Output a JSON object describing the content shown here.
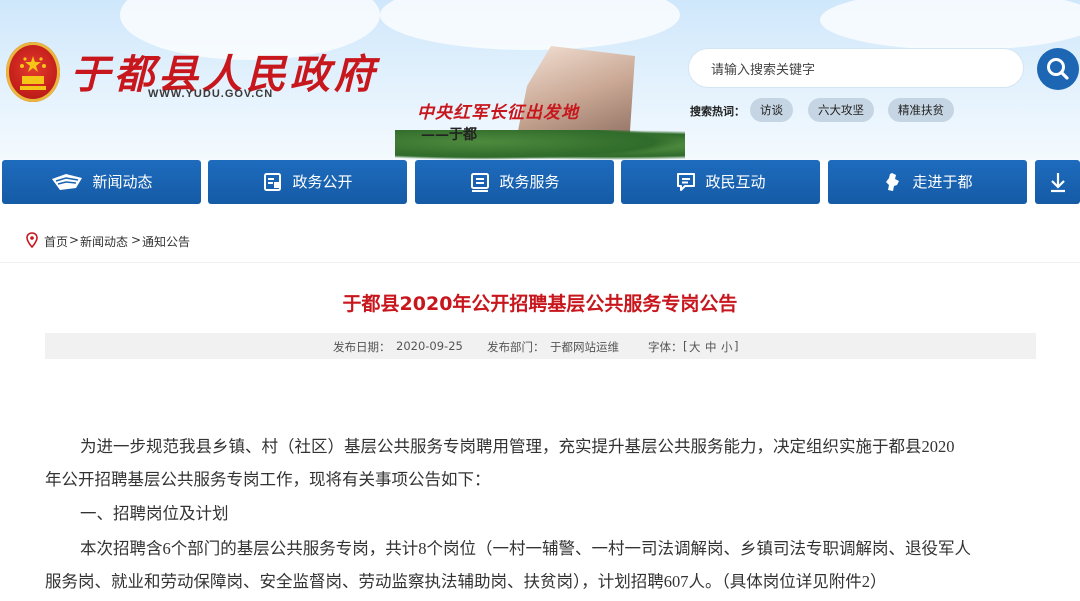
{
  "header": {
    "site_name": "于都县人民政府",
    "site_url": "WWW.YUDU.GOV.CN",
    "slogan": "中央红军长征出发地",
    "slogan_sub": "——于都",
    "search_placeholder": "请输入搜索关键字",
    "hot_label": "搜索热词：",
    "hot_tags": [
      "访谈",
      "六大攻坚",
      "精准扶贫"
    ]
  },
  "nav": {
    "items": [
      {
        "label": "新闻动态",
        "icon": "news-icon"
      },
      {
        "label": "政务公开",
        "icon": "document-icon"
      },
      {
        "label": "政务服务",
        "icon": "service-icon"
      },
      {
        "label": "政民互动",
        "icon": "chat-icon"
      },
      {
        "label": "走进于都",
        "icon": "map-icon"
      }
    ],
    "more_icon": "arrow-down-icon"
  },
  "breadcrumb": {
    "home": "首页",
    "sep": ">",
    "section": "新闻动态",
    "page": "通知公告"
  },
  "article": {
    "title": "于都县2020年公开招聘基层公共服务专岗公告",
    "date_label": "发布日期：",
    "date": "2020-09-25",
    "dept_label": "发布部门：",
    "dept": "于都网站运维",
    "font_label": "字体：",
    "font_open": "[",
    "font_large": "大",
    "font_medium": "中",
    "font_small": "小",
    "font_close": "]",
    "p1_line1": "为进一步规范我县乡镇、村（社区）基层公共服务专岗聘用管理，充实提升基层公共服务能力，决定组织实施于都县2020",
    "p1_line2": "年公开招聘基层公共服务专岗工作，现将有关事项公告如下：",
    "section1": "一、招聘岗位及计划",
    "p2_line1": "本次招聘含6个部门的基层公共服务专岗，共计8个岗位（一村一辅警、一村一司法调解岗、乡镇司法专职调解岗、退役军人",
    "p2_line2": "服务岗、就业和劳动保障岗、安全监督岗、劳动监察执法辅助岗、扶贫岗），计划招聘607人。（具体岗位详见附件2）"
  },
  "colors": {
    "brand_red": "#c8161d",
    "nav_blue": "#1a63b1"
  }
}
